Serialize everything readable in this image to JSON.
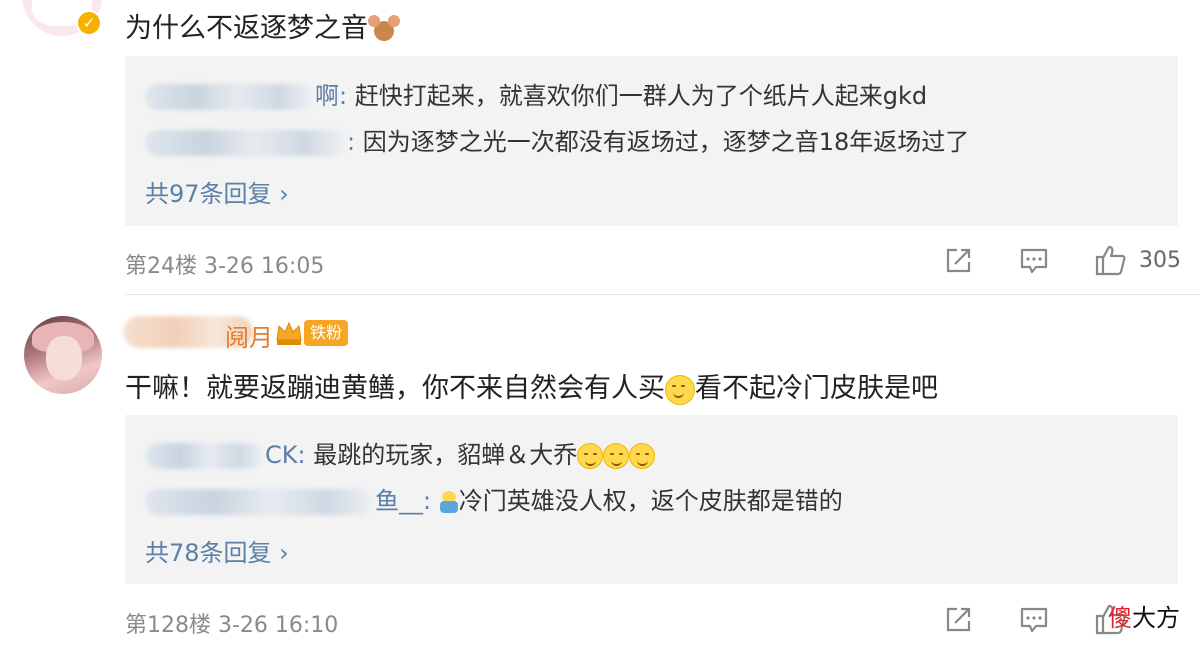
{
  "comments": [
    {
      "text": "为什么不返逐梦之音",
      "replies": [
        {
          "name_visible": "啊",
          "text": "赶快打起来，就喜欢你们一群人为了个纸片人起来gkd"
        },
        {
          "name_visible": "",
          "text": "因为逐梦之光一次都没有返场过，逐梦之音18年返场过了"
        }
      ],
      "more_replies": "共97条回复 ›",
      "floor_time": "第24楼  3-26 16:05",
      "likes": "305"
    },
    {
      "name_tail": "阋月",
      "fan_badge": "铁粉",
      "text_part1": "干嘛！就要返蹦迪黄鳝，你不来自然会有人买",
      "text_part2": "看不起冷门皮肤是吧",
      "replies": [
        {
          "name_visible": "CK",
          "text": "最跳的玩家，貂蝉＆大乔"
        },
        {
          "name_visible": "鱼__",
          "text": "冷门英雄没人权，返个皮肤都是错的"
        }
      ],
      "more_replies": "共78条回复 ›",
      "floor_time": "第128楼  3-26 16:10",
      "likes": ""
    }
  ],
  "watermark": {
    "first": "傻",
    "rest": "大方"
  },
  "icons": [
    "share-icon",
    "comment-icon",
    "thumbs-up-icon"
  ],
  "colors": {
    "link": "#5b7fa6",
    "badge": "#f5a623",
    "meta": "#8a8a8a",
    "reply_bg": "#f3f3f3"
  }
}
